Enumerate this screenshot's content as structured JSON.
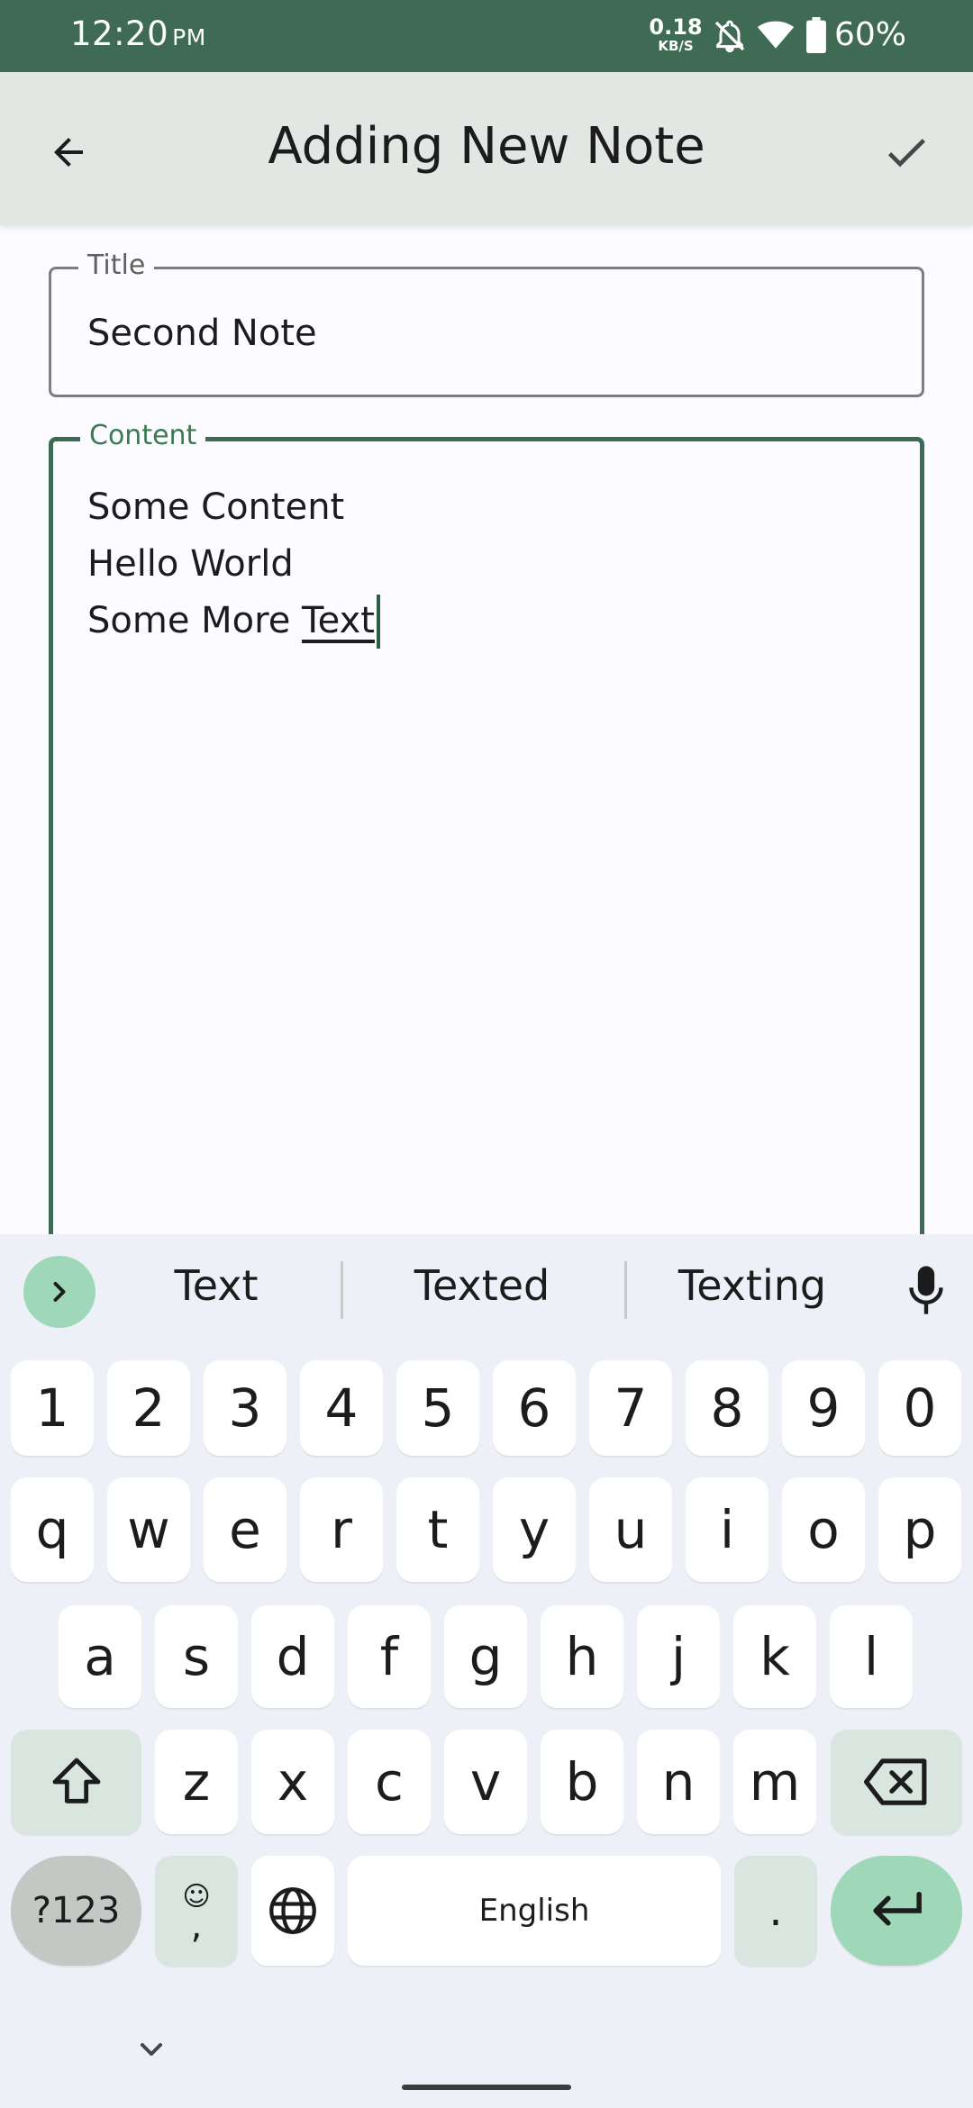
{
  "status_bar": {
    "time": "12:20",
    "ampm": "PM",
    "net_speed_value": "0.18",
    "net_speed_unit": "KB/S",
    "battery": "60%",
    "icons": [
      "bell-off-icon",
      "wifi-icon",
      "battery-icon"
    ],
    "background": "#3f6b55"
  },
  "app_bar": {
    "title": "Adding New Note",
    "back_icon": "arrow-left-icon",
    "save_icon": "check-icon"
  },
  "title_field": {
    "label": "Title",
    "value": "Second Note"
  },
  "content_field": {
    "label": "Content",
    "lines": [
      "Some Content",
      "Hello World",
      "Some More "
    ],
    "composing_word": "Text",
    "accent_color": "#3b6b52"
  },
  "keyboard": {
    "suggestions": [
      "Text",
      "Texted",
      "Texting"
    ],
    "number_row": [
      "1",
      "2",
      "3",
      "4",
      "5",
      "6",
      "7",
      "8",
      "9",
      "0"
    ],
    "row1": [
      "q",
      "w",
      "e",
      "r",
      "t",
      "y",
      "u",
      "i",
      "o",
      "p"
    ],
    "row2": [
      "a",
      "s",
      "d",
      "f",
      "g",
      "h",
      "j",
      "k",
      "l"
    ],
    "row3": [
      "z",
      "x",
      "c",
      "v",
      "b",
      "n",
      "m"
    ],
    "symbols_key": "?123",
    "emoji_key_top": "☺",
    "emoji_key_bottom": ",",
    "space_label": "English",
    "period_key": ".",
    "accent_color": "#9ed8b9"
  }
}
